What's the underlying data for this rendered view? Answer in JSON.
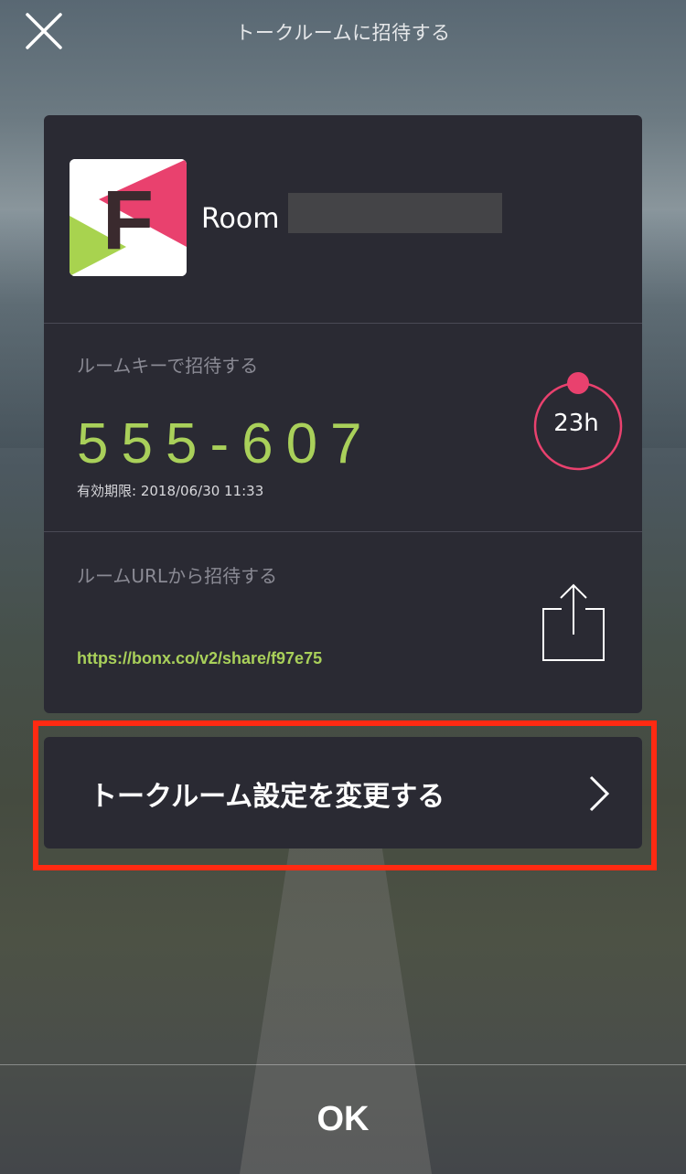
{
  "header": {
    "title": "トークルームに招待する",
    "close_icon": "close-icon"
  },
  "room": {
    "name": "Room",
    "logo_letter": "F",
    "logo_colors": {
      "pink": "#e9416e",
      "green": "#a8d34f",
      "letter": "#3a2a2e"
    }
  },
  "room_key": {
    "label": "ルームキーで招待する",
    "code": "555-607",
    "expiry": "有効期限: 2018/06/30 11:33",
    "timer_label": "23h",
    "accent_color": "#e9416e",
    "code_color": "#a9d05a"
  },
  "room_url": {
    "label": "ルームURLから招待する",
    "url": "https://bonx.co/v2/share/f97e75",
    "share_icon": "share-icon"
  },
  "settings": {
    "label": "トークルーム設定を変更する",
    "chevron_icon": "chevron-right-icon",
    "highlight_color": "#ff2a12"
  },
  "footer": {
    "ok_label": "OK"
  }
}
